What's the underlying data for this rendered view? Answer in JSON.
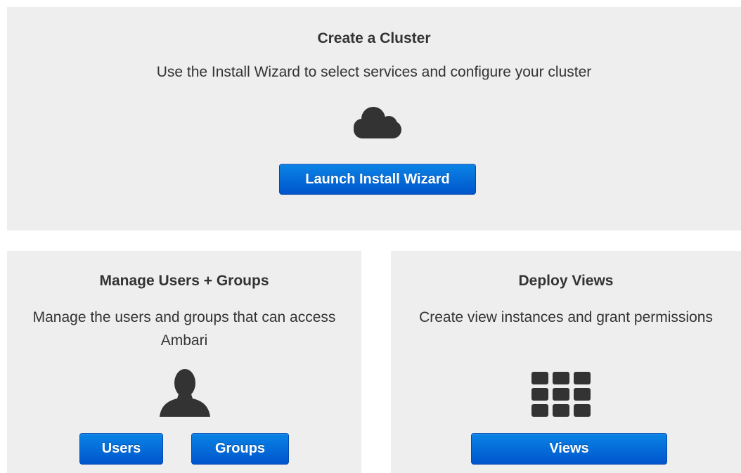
{
  "create_cluster": {
    "title": "Create a Cluster",
    "description": "Use the Install Wizard to select services and configure your cluster",
    "icon": "cloud-icon",
    "button_label": "Launch Install Wizard"
  },
  "manage_users": {
    "title": "Manage Users + Groups",
    "description": "Manage the users and groups that can access Ambari",
    "icon": "user-icon",
    "users_button_label": "Users",
    "groups_button_label": "Groups"
  },
  "deploy_views": {
    "title": "Deploy Views",
    "description": "Create view instances and grant permissions",
    "icon": "grid-icon",
    "button_label": "Views"
  },
  "colors": {
    "panel_background": "#eeeeee",
    "button_blue": "#0066dd",
    "icon_dark": "#333333",
    "text": "#333333"
  }
}
